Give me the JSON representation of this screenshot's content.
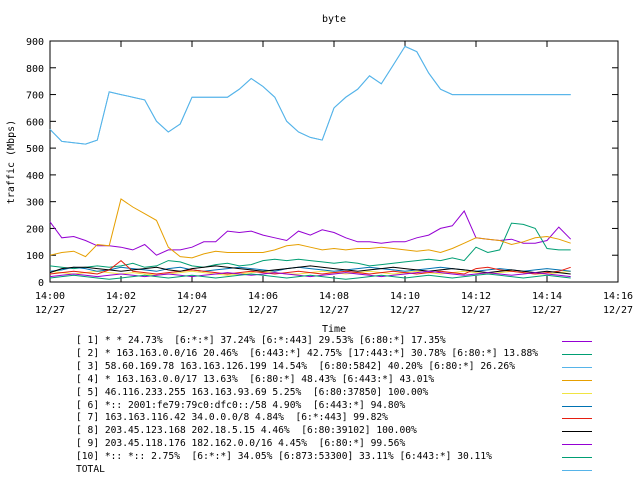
{
  "chart_data": {
    "type": "line",
    "title": "byte",
    "xlabel": "Time",
    "ylabel": "traffic (Mbps)",
    "ylim": [
      0,
      900
    ],
    "yticks": [
      "0",
      "100",
      "200",
      "300",
      "400",
      "500",
      "600",
      "700",
      "800",
      "900"
    ],
    "xticks": [
      {
        "time": "14:00",
        "date": "12/27"
      },
      {
        "time": "14:02",
        "date": "12/27"
      },
      {
        "time": "14:04",
        "date": "12/27"
      },
      {
        "time": "14:06",
        "date": "12/27"
      },
      {
        "time": "14:08",
        "date": "12/27"
      },
      {
        "time": "14:10",
        "date": "12/27"
      },
      {
        "time": "14:12",
        "date": "12/27"
      },
      {
        "time": "14:14",
        "date": "12/27"
      },
      {
        "time": "14:16",
        "date": "12/27"
      }
    ],
    "xlim": [
      "14:00",
      "14:16"
    ],
    "x": [
      "14:00:00",
      "14:00:20",
      "14:00:40",
      "14:01:00",
      "14:01:20",
      "14:01:40",
      "14:02:00",
      "14:02:20",
      "14:02:40",
      "14:03:00",
      "14:03:20",
      "14:03:40",
      "14:04:00",
      "14:04:20",
      "14:04:40",
      "14:05:00",
      "14:05:20",
      "14:05:40",
      "14:06:00",
      "14:06:20",
      "14:06:40",
      "14:07:00",
      "14:07:20",
      "14:07:40",
      "14:08:00",
      "14:08:20",
      "14:08:40",
      "14:09:00",
      "14:09:20",
      "14:09:40",
      "14:10:00",
      "14:10:20",
      "14:10:40",
      "14:11:00",
      "14:11:20",
      "14:11:40",
      "14:12:00",
      "14:12:20",
      "14:12:40",
      "14:13:00",
      "14:13:20",
      "14:13:40",
      "14:14:00",
      "14:14:20",
      "14:14:40"
    ],
    "grid": false,
    "legend_position": "bottom",
    "series": [
      {
        "name": "[ 1] * * 24.73%  [6:*:*] 37.24% [6:*:443] 29.53% [6:80:*] 17.35%",
        "color": "#9500d3",
        "values": [
          225,
          165,
          170,
          155,
          135,
          135,
          130,
          120,
          140,
          100,
          120,
          120,
          130,
          150,
          150,
          190,
          185,
          190,
          175,
          165,
          155,
          190,
          175,
          195,
          185,
          165,
          150,
          150,
          145,
          150,
          150,
          165,
          175,
          200,
          210,
          265,
          165,
          160,
          155,
          160,
          145,
          145,
          155,
          205,
          160
        ]
      },
      {
        "name": "[ 2] * 163.163.0.0/16 20.46%  [6:443:*] 42.75% [17:443:*] 30.78% [6:80:*] 13.88%",
        "color": "#009e73",
        "values": [
          60,
          55,
          50,
          55,
          60,
          55,
          60,
          70,
          55,
          60,
          80,
          75,
          60,
          55,
          65,
          70,
          60,
          65,
          80,
          85,
          80,
          85,
          80,
          75,
          70,
          75,
          70,
          60,
          65,
          70,
          75,
          80,
          85,
          80,
          90,
          80,
          130,
          110,
          120,
          220,
          215,
          200,
          125,
          120,
          120
        ]
      },
      {
        "name": "[ 3] 58.60.169.78 163.163.126.199 14.54%  [6:80:5842] 40.20% [6:80:*] 26.26%",
        "color": "#56b4e9",
        "values": [
          570,
          525,
          520,
          515,
          530,
          710,
          700,
          690,
          680,
          600,
          560,
          590,
          690,
          690,
          690,
          690,
          720,
          760,
          730,
          690,
          600,
          560,
          540,
          530,
          650,
          690,
          720,
          770,
          740,
          810,
          880,
          860,
          780,
          720,
          700,
          700,
          700,
          700,
          700,
          700,
          700,
          700,
          700,
          700,
          700
        ]
      },
      {
        "name": "[ 4] * 163.163.0.0/17 13.63%  [6:80:*] 48.43% [6:443:*] 43.01%",
        "color": "#e69f00",
        "values": [
          100,
          110,
          115,
          95,
          140,
          135,
          310,
          280,
          255,
          230,
          130,
          95,
          90,
          105,
          115,
          110,
          110,
          110,
          110,
          120,
          135,
          140,
          130,
          120,
          125,
          120,
          125,
          125,
          130,
          125,
          120,
          115,
          120,
          110,
          125,
          145,
          165,
          160,
          155,
          140,
          150,
          165,
          170,
          160,
          145
        ]
      },
      {
        "name": "[ 5] 46.116.233.255 163.163.93.69 5.25%  [6:80:37850] 100.00%",
        "color": "#f0e442",
        "values": [
          40,
          35,
          30,
          35,
          40,
          35,
          30,
          35,
          30,
          25,
          30,
          35,
          40,
          35,
          30,
          25,
          30,
          35,
          40,
          35,
          30,
          30,
          35,
          40,
          35,
          30,
          35,
          40,
          35,
          30,
          35,
          40,
          35,
          30,
          35,
          40,
          35,
          30,
          35,
          40,
          35,
          30,
          30,
          35,
          40
        ]
      },
      {
        "name": "[ 6] *:: 2001:fe79:79c0:dfc0::/58 4.90%  [6:443:*] 94.80%",
        "color": "#0072b2",
        "values": [
          40,
          45,
          55,
          50,
          40,
          45,
          55,
          50,
          45,
          40,
          50,
          55,
          45,
          40,
          45,
          50,
          55,
          50,
          45,
          40,
          50,
          55,
          50,
          45,
          40,
          45,
          50,
          55,
          50,
          45,
          40,
          45,
          50,
          55,
          50,
          45,
          40,
          45,
          50,
          45,
          40,
          45,
          50,
          45,
          40
        ]
      },
      {
        "name": "[ 7] 163.163.116.42 34.0.0.0/8 4.84%  [6:*:443] 99.82%",
        "color": "#e51e10",
        "values": [
          30,
          35,
          40,
          35,
          30,
          45,
          80,
          40,
          35,
          30,
          35,
          40,
          45,
          40,
          35,
          30,
          35,
          40,
          35,
          30,
          35,
          40,
          35,
          30,
          35,
          40,
          35,
          30,
          35,
          40,
          35,
          30,
          35,
          40,
          35,
          30,
          50,
          55,
          45,
          40,
          35,
          30,
          35,
          40,
          55
        ]
      },
      {
        "name": "[ 8] 203.45.123.168 202.18.5.15 4.46%  [6:80:39102] 100.00%",
        "color": "#000000",
        "values": [
          35,
          50,
          55,
          55,
          50,
          45,
          40,
          45,
          50,
          55,
          45,
          40,
          50,
          55,
          60,
          55,
          50,
          45,
          40,
          45,
          50,
          55,
          60,
          55,
          50,
          45,
          40,
          45,
          50,
          55,
          50,
          45,
          40,
          45,
          50,
          45,
          40,
          35,
          40,
          45,
          40,
          35,
          40,
          35,
          30
        ]
      },
      {
        "name": "[ 9] 203.45.118.176 182.162.0.0/16 4.45%  [6:80:*] 99.56%",
        "color": "#9400d3",
        "values": [
          20,
          25,
          30,
          25,
          20,
          25,
          30,
          25,
          20,
          25,
          30,
          25,
          20,
          25,
          30,
          35,
          30,
          25,
          30,
          35,
          30,
          25,
          20,
          25,
          30,
          35,
          30,
          25,
          20,
          25,
          30,
          35,
          40,
          35,
          30,
          25,
          30,
          35,
          30,
          25,
          30,
          35,
          30,
          25,
          20
        ]
      },
      {
        "name": "[10] *:: *:: 2.75%  [6:*:*] 34.05% [6:873:53300] 33.11% [6:443:*] 30.11%",
        "color": "#009e73",
        "values": [
          15,
          20,
          25,
          20,
          15,
          10,
          15,
          20,
          25,
          20,
          15,
          20,
          25,
          20,
          15,
          20,
          25,
          30,
          25,
          20,
          15,
          20,
          25,
          20,
          15,
          10,
          15,
          20,
          25,
          20,
          15,
          20,
          25,
          20,
          15,
          20,
          25,
          30,
          25,
          20,
          15,
          20,
          25,
          20,
          15
        ]
      },
      {
        "name": "TOTAL",
        "color": "#56b4e9",
        "values": [
          570,
          525,
          520,
          515,
          530,
          710,
          700,
          690,
          680,
          600,
          560,
          590,
          690,
          690,
          690,
          690,
          720,
          760,
          730,
          690,
          600,
          560,
          540,
          530,
          650,
          690,
          720,
          770,
          740,
          810,
          880,
          860,
          780,
          720,
          700,
          700,
          700,
          700,
          700,
          700,
          700,
          700,
          700,
          700,
          700
        ]
      }
    ]
  }
}
